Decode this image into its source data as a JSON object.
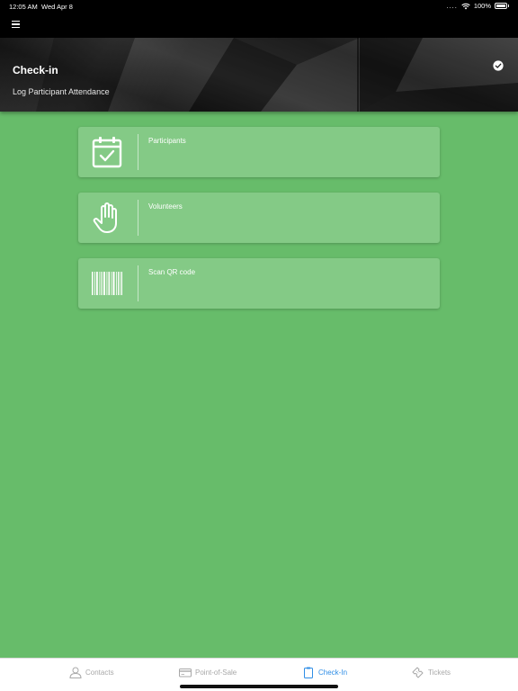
{
  "status_bar": {
    "time": "12:05 AM",
    "date": "Wed Apr 8",
    "signal": "....",
    "battery_percent": "100%"
  },
  "header": {
    "title": "Check-in",
    "subtitle": "Log Participant Attendance",
    "action_icon": "check-circle-icon"
  },
  "cards": [
    {
      "label": "Participants",
      "icon": "calendar-check-icon"
    },
    {
      "label": "Volunteers",
      "icon": "raised-hand-icon"
    },
    {
      "label": "Scan QR code",
      "icon": "barcode-icon"
    }
  ],
  "tabs": [
    {
      "label": "Contacts",
      "icon": "person-icon",
      "active": false
    },
    {
      "label": "Point-of-Sale",
      "icon": "credit-card-icon",
      "active": false
    },
    {
      "label": "Check-In",
      "icon": "clipboard-icon",
      "active": true
    },
    {
      "label": "Tickets",
      "icon": "ticket-icon",
      "active": false
    }
  ],
  "colors": {
    "background": "#67bc6a",
    "card": "#84ca86",
    "tab_active": "#2f8ee6",
    "tab_inactive": "#a8a8a8"
  }
}
